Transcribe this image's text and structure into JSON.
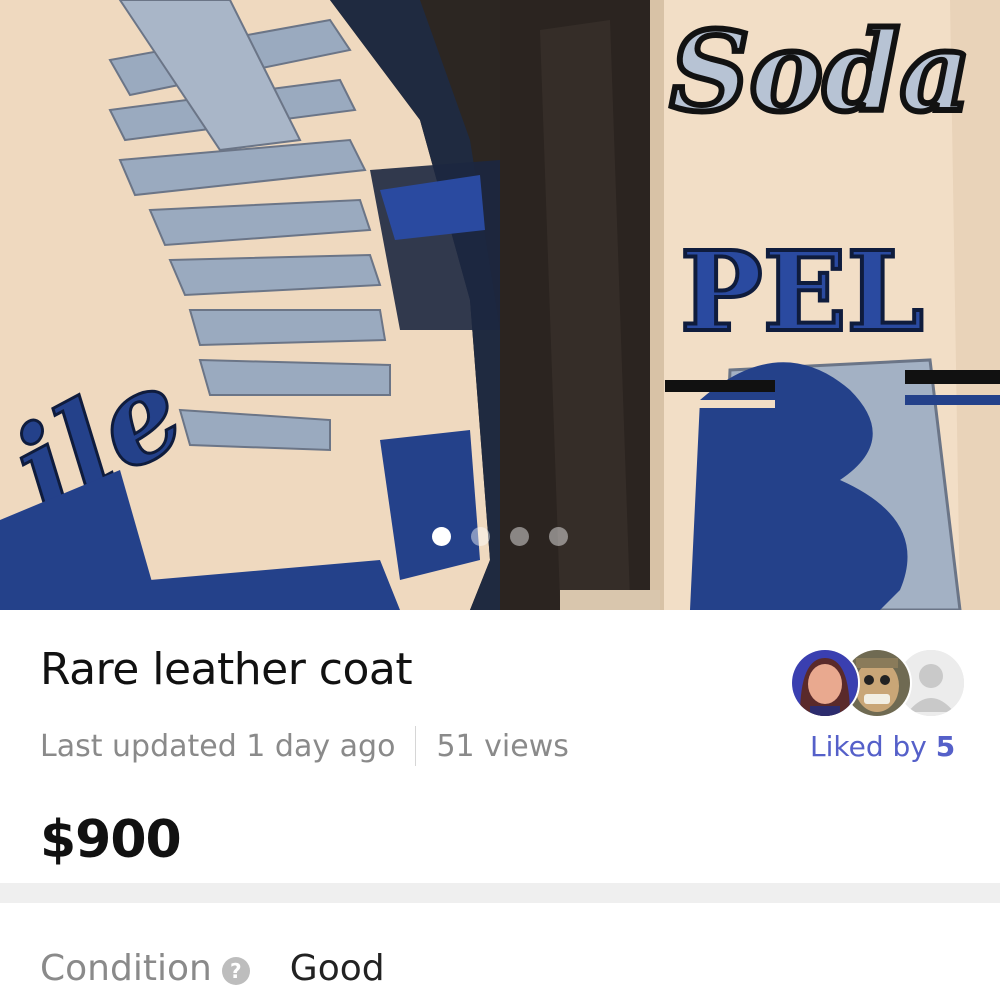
{
  "gallery": {
    "image_alt": "Cream leather jacket with blue and grey patches",
    "patch_texts": [
      "Soda",
      "PEL",
      "ile"
    ],
    "page_count": 4,
    "active_page": 1
  },
  "listing": {
    "title": "Rare leather coat",
    "last_updated": "Last updated 1 day ago",
    "views": "51 views",
    "price": "$900"
  },
  "likes": {
    "label": "Liked by",
    "count": "5"
  },
  "details": {
    "condition_label": "Condition",
    "help_glyph": "?",
    "condition_value": "Good"
  },
  "colors": {
    "accent": "#5560c9",
    "muted_text": "#8a8a8a",
    "jacket_cream": "#f1dcc4",
    "jacket_blue": "#24418a",
    "jacket_grey": "#9aaabf"
  }
}
